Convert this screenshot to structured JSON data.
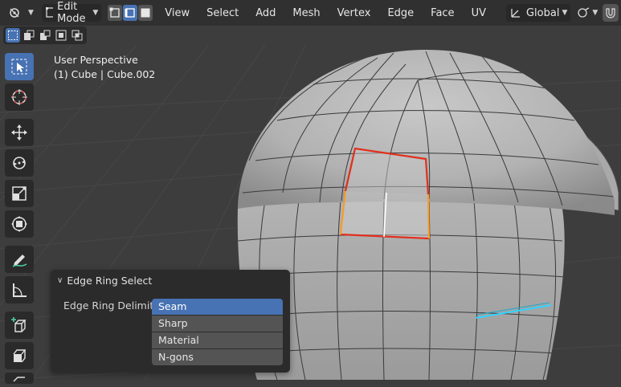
{
  "header": {
    "mode_label": "Edit Mode",
    "menu": [
      "View",
      "Select",
      "Add",
      "Mesh",
      "Vertex",
      "Edge",
      "Face",
      "UV"
    ],
    "transform_orientation": "Global"
  },
  "select_mode": {
    "active": "edge"
  },
  "viewport": {
    "perspective": "User Perspective",
    "object_info": "(1) Cube | Cube.002"
  },
  "panel": {
    "title": "Edge Ring Select",
    "delimit_label": "Edge Ring Delimit",
    "options": [
      {
        "label": "Seam",
        "active": true
      },
      {
        "label": "Sharp",
        "active": false
      },
      {
        "label": "Material",
        "active": false
      },
      {
        "label": "N-gons",
        "active": false
      }
    ]
  },
  "colors": {
    "accent": "#4772b3",
    "selected_edge": "#e0301e",
    "active_edge": "#ff9a1e",
    "seam_highlight": "#2fd4ff"
  }
}
